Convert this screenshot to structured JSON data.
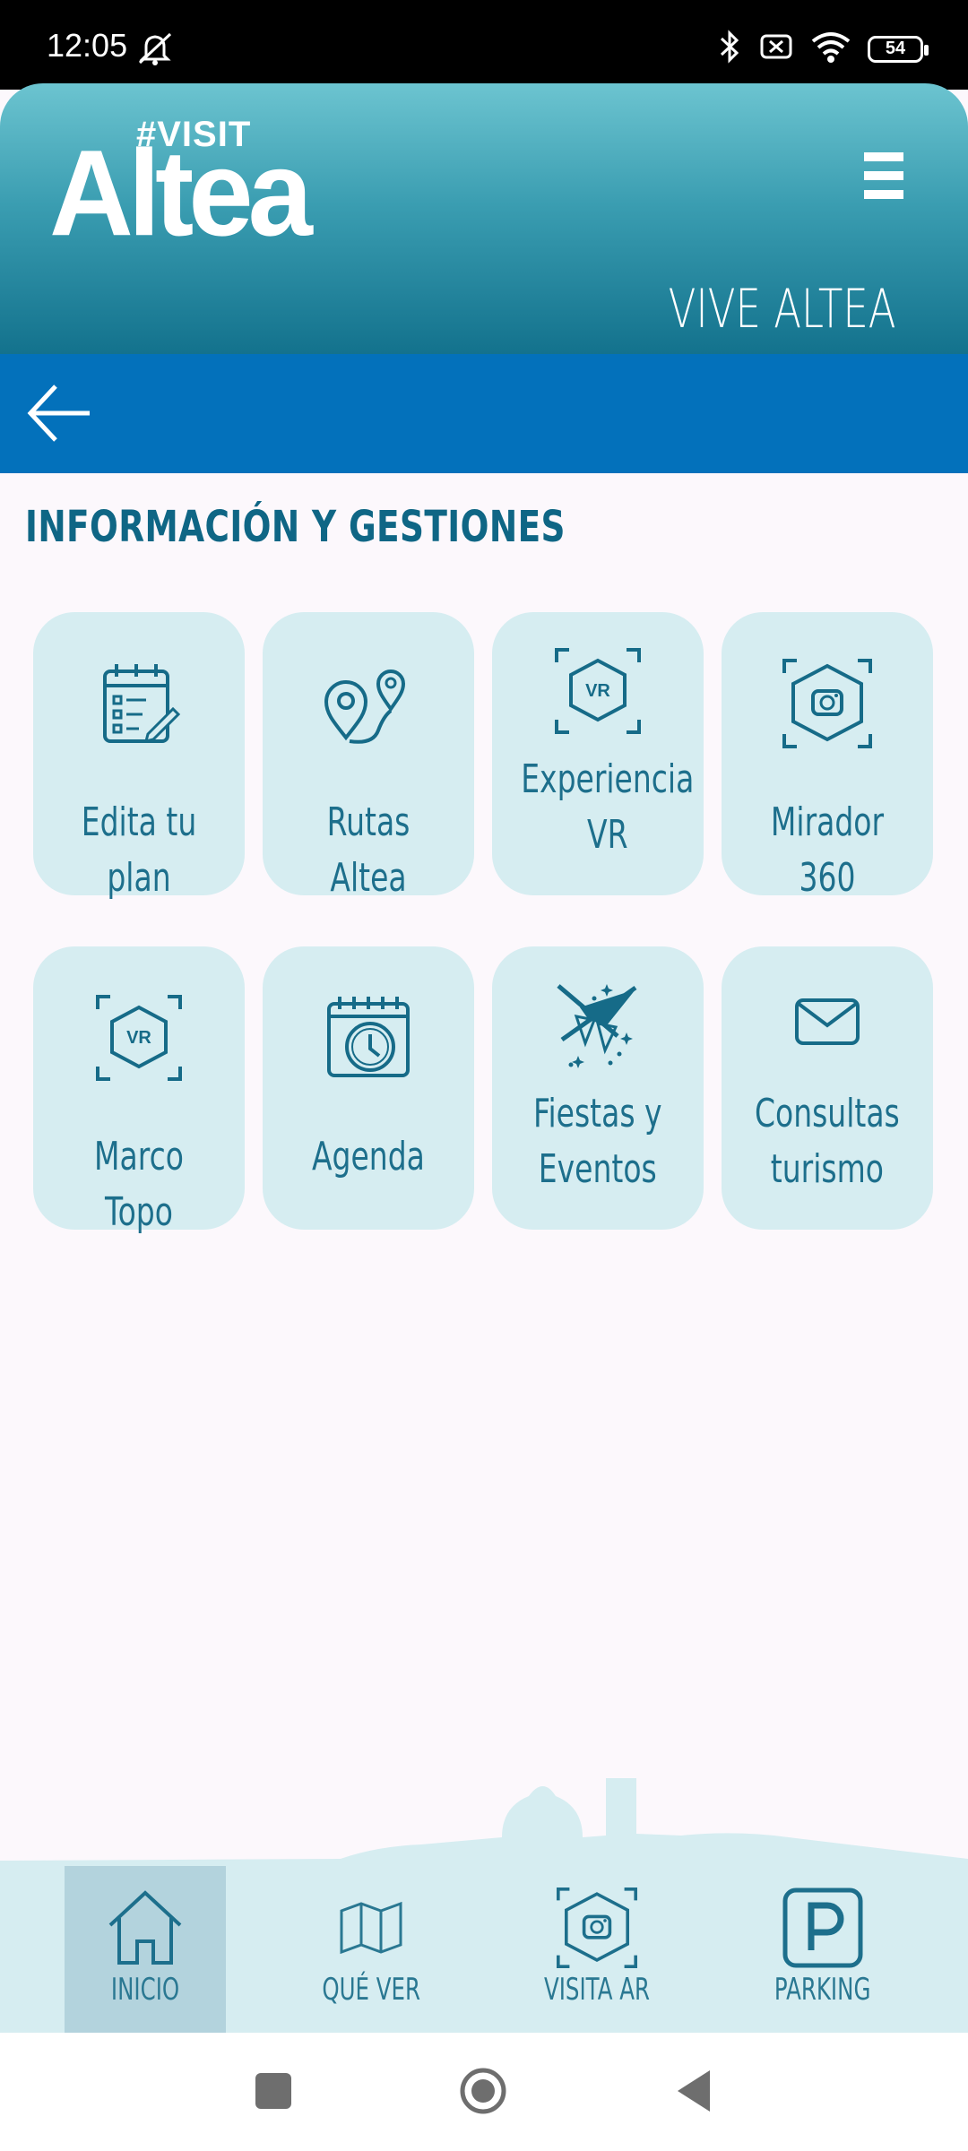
{
  "status_bar": {
    "time": "12:05",
    "battery": "54",
    "icons": [
      "mute-icon",
      "bluetooth-icon",
      "sim-icon",
      "wifi-icon",
      "battery-icon"
    ]
  },
  "header": {
    "logo_visit": "#VISIT",
    "logo_name": "Altea",
    "tagline": "VIVE ALTEA",
    "gradient": [
      "#6cc4d0",
      "#13728d"
    ]
  },
  "nav_bar": {
    "color": "#0371bb",
    "back_icon": "arrow-left-icon"
  },
  "section": {
    "title": "INFORMACIÓN Y GESTIONES"
  },
  "tiles": [
    {
      "label": "Edita tu plan",
      "icon": "calendar-list-icon"
    },
    {
      "label": "Rutas Altea",
      "icon": "route-pins-icon"
    },
    {
      "label": "Experiencia\nVR",
      "icon": "vr-hexagon-icon"
    },
    {
      "label": "Mirador 360",
      "icon": "camera-hexagon-icon"
    },
    {
      "label": "Marco Topo",
      "icon": "vr-hexagon-icon"
    },
    {
      "label": "Agenda",
      "icon": "calendar-clock-icon"
    },
    {
      "label": "Fiestas y\nEventos",
      "icon": "festival-icon"
    },
    {
      "label": "Consultas\nturismo",
      "icon": "envelope-icon"
    }
  ],
  "bottom_nav": [
    {
      "label": "INICIO",
      "icon": "home-icon",
      "active": true
    },
    {
      "label": "QUÉ VER",
      "icon": "map-icon",
      "active": false
    },
    {
      "label": "VISITA AR",
      "icon": "camera-hexagon-icon",
      "active": false
    },
    {
      "label": "PARKING",
      "icon": "parking-icon",
      "active": false
    }
  ],
  "colors": {
    "accent": "#0371bb",
    "tile_bg": "#d6edf1",
    "text": "#1d6f8c",
    "page_bg": "#fcf8fc"
  }
}
